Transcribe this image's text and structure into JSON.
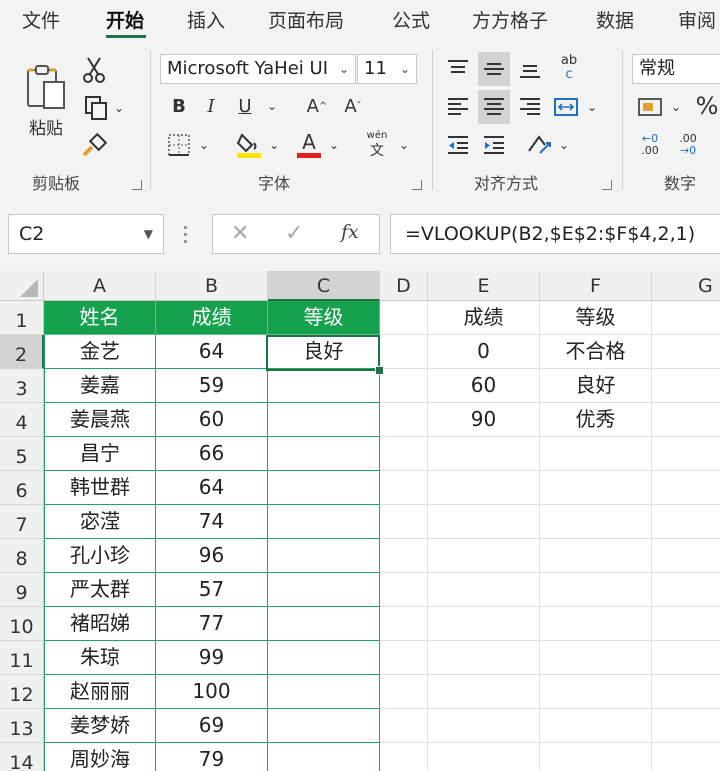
{
  "tabs": [
    "文件",
    "开始",
    "插入",
    "页面布局",
    "公式",
    "方方格子",
    "数据",
    "审阅"
  ],
  "active_tab": "开始",
  "ribbon": {
    "clipboard": {
      "paste_label": "粘贴",
      "group_label": "剪贴板"
    },
    "font": {
      "font_name": "Microsoft YaHei UI",
      "font_size": "11",
      "bold": "B",
      "italic": "I",
      "underline": "U",
      "grow": "A",
      "shrink": "A",
      "font_color": "A",
      "phonetic_top": "wén",
      "phonetic_bottom": "文",
      "group_label": "字体"
    },
    "alignment": {
      "group_label": "对齐方式",
      "wrap_top": "ab",
      "wrap_bottom": "c"
    },
    "number": {
      "format": "常规",
      "percent": "%",
      "inc_decimal": ".00",
      "dec_decimal": ".00",
      "group_label": "数字"
    }
  },
  "colors": {
    "accent": "#217346",
    "header_fill": "#16a14f",
    "highlight": "#ffe600",
    "font_red": "#e02020"
  },
  "formula_bar": {
    "name_box": "C2",
    "formula": "=VLOOKUP(B2,$E$2:$F$4,2,1)",
    "fx": "fx"
  },
  "grid": {
    "columns": [
      "A",
      "B",
      "C",
      "D",
      "E",
      "F",
      "G"
    ],
    "rows": [
      "1",
      "2",
      "3",
      "4",
      "5",
      "6",
      "7",
      "8",
      "9",
      "10",
      "11",
      "12",
      "13",
      "14"
    ],
    "headers": {
      "name": "姓名",
      "score": "成绩",
      "grade": "等级"
    },
    "records": [
      {
        "name": "金艺",
        "score": "64",
        "grade": "良好"
      },
      {
        "name": "姜嘉",
        "score": "59",
        "grade": ""
      },
      {
        "name": "姜晨燕",
        "score": "60",
        "grade": ""
      },
      {
        "name": "昌宁",
        "score": "66",
        "grade": ""
      },
      {
        "name": "韩世群",
        "score": "64",
        "grade": ""
      },
      {
        "name": "宓滢",
        "score": "74",
        "grade": ""
      },
      {
        "name": "孔小珍",
        "score": "96",
        "grade": ""
      },
      {
        "name": "严太群",
        "score": "57",
        "grade": ""
      },
      {
        "name": "褚昭娣",
        "score": "77",
        "grade": ""
      },
      {
        "name": "朱琼",
        "score": "99",
        "grade": ""
      },
      {
        "name": "赵丽丽",
        "score": "100",
        "grade": ""
      },
      {
        "name": "姜梦娇",
        "score": "69",
        "grade": ""
      },
      {
        "name": "周妙海",
        "score": "79",
        "grade": ""
      }
    ],
    "lookup": {
      "header_score": "成绩",
      "header_grade": "等级",
      "rows": [
        {
          "score": "0",
          "grade": "不合格"
        },
        {
          "score": "60",
          "grade": "良好"
        },
        {
          "score": "90",
          "grade": "优秀"
        }
      ]
    }
  }
}
